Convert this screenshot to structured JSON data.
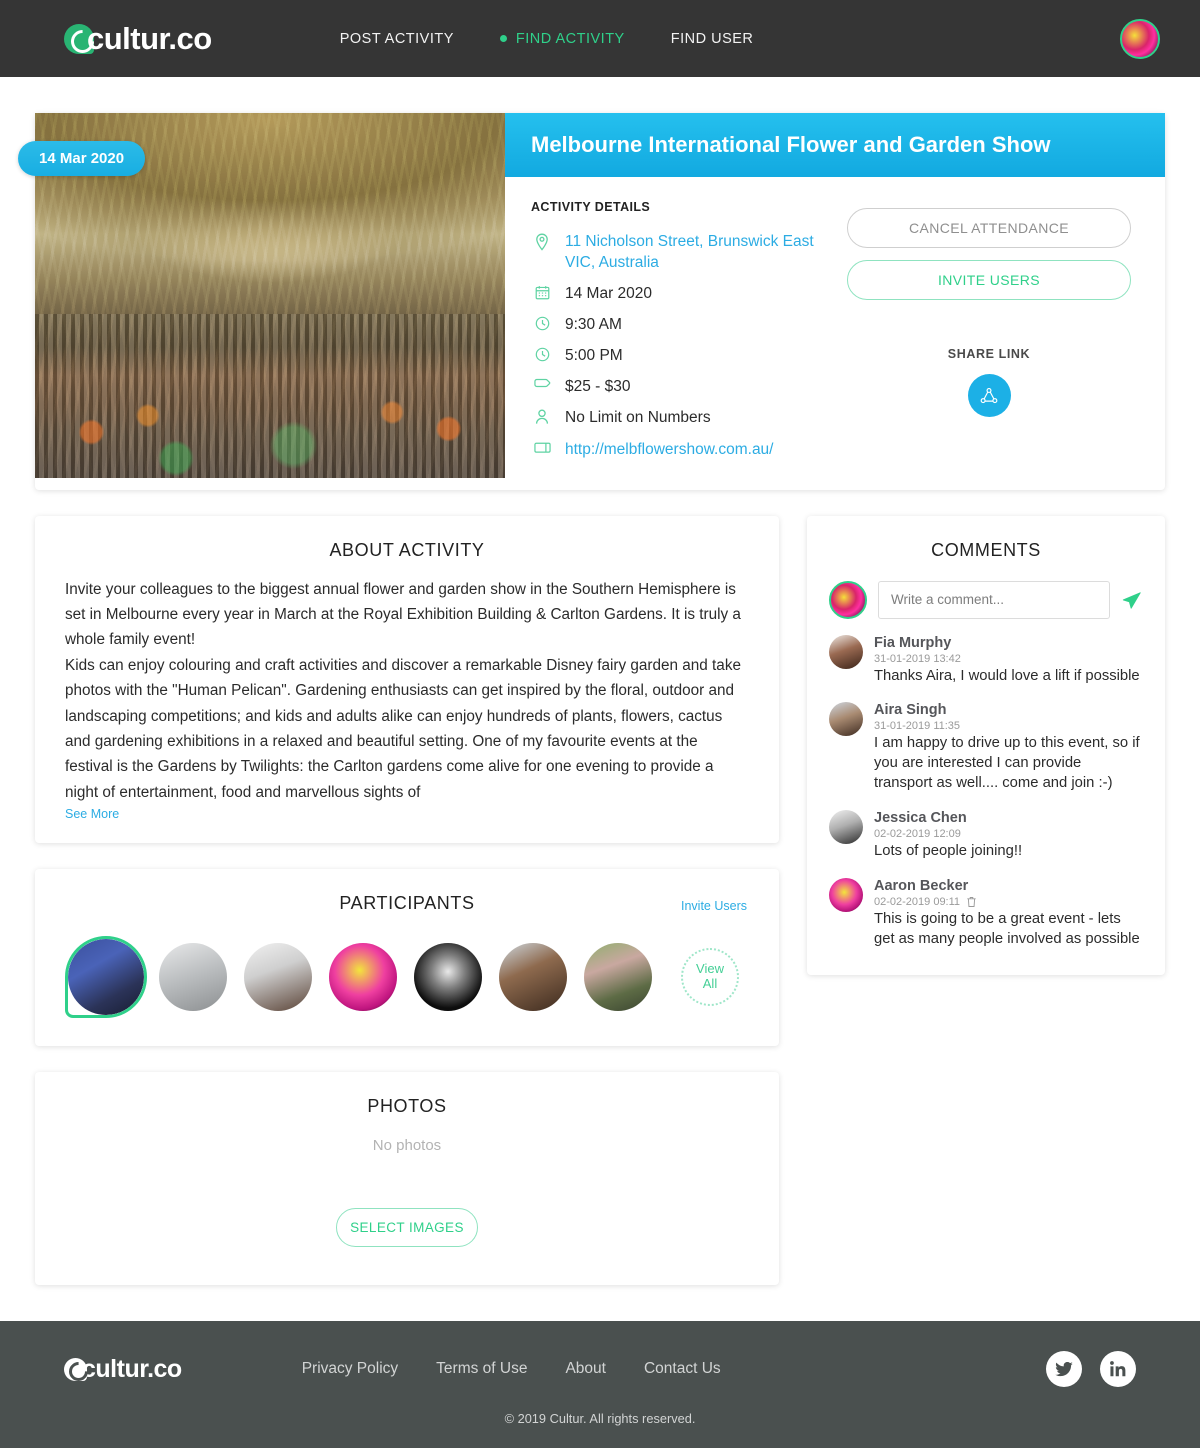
{
  "header": {
    "logo": "cultur.co",
    "nav": [
      {
        "label": "POST ACTIVITY",
        "active": false
      },
      {
        "label": "FIND ACTIVITY",
        "active": true
      },
      {
        "label": "FIND USER",
        "active": false
      }
    ],
    "avatar_name": "user-avatar"
  },
  "hero": {
    "date_badge": "14 Mar 2020",
    "title": "Melbourne International Flower and Garden Show",
    "details_heading": "ACTIVITY DETAILS",
    "details": [
      {
        "icon": "location-pin-icon",
        "text": "11 Nicholson Street, Brunswick East VIC, Australia",
        "link": true
      },
      {
        "icon": "calendar-icon",
        "text": "14 Mar 2020",
        "link": false
      },
      {
        "icon": "clock-icon",
        "text": "9:30 AM",
        "link": false
      },
      {
        "icon": "clock-icon",
        "text": "5:00 PM",
        "link": false
      },
      {
        "icon": "price-tag-icon",
        "text": "$25 - $30",
        "link": false
      },
      {
        "icon": "person-icon",
        "text": "No Limit on Numbers",
        "link": false
      },
      {
        "icon": "web-icon",
        "text": "http://melbflowershow.com.au/",
        "link": true
      }
    ],
    "cancel_label": "CANCEL ATTENDANCE",
    "invite_label": "INVITE USERS",
    "share_label": "SHARE LINK"
  },
  "about": {
    "title": "ABOUT ACTIVITY",
    "paragraphs": [
      "Invite your colleagues to the biggest annual flower and garden show in the Southern Hemisphere is set in Melbourne every year in March at the Royal Exhibition Building & Carlton Gardens. It is truly a whole family event!",
      "Kids can enjoy colouring and craft activities and discover a remarkable Disney fairy garden and take photos with the \"Human Pelican\". Gardening enthusiasts can get inspired by the floral, outdoor and landscaping competitions; and kids and adults alike can enjoy hundreds of plants, flowers, cactus and gardening exhibitions in a relaxed and beautiful setting. One of my favourite events at the festival is the Gardens by Twilights: the Carlton gardens come alive for one evening to provide a night of entertainment, food and marvellous sights of"
    ],
    "see_more": "See More"
  },
  "participants": {
    "title": "PARTICIPANTS",
    "invite_link": "Invite Users",
    "view_all_line1": "View",
    "view_all_line2": "All",
    "avatars": [
      {
        "name": "participant-avatar-1",
        "highlighted": true
      },
      {
        "name": "participant-avatar-2",
        "highlighted": false
      },
      {
        "name": "participant-avatar-3",
        "highlighted": false
      },
      {
        "name": "participant-avatar-4",
        "highlighted": false
      },
      {
        "name": "participant-avatar-5",
        "highlighted": false
      },
      {
        "name": "participant-avatar-6",
        "highlighted": false
      },
      {
        "name": "participant-avatar-7",
        "highlighted": false
      }
    ]
  },
  "photos": {
    "title": "PHOTOS",
    "empty_text": "No photos",
    "select_label": "SELECT IMAGES"
  },
  "comments": {
    "title": "COMMENTS",
    "placeholder": "Write a comment...",
    "input_value": "",
    "items": [
      {
        "name": "Fia Murphy",
        "timestamp": "31-01-2019 13:42",
        "text": "Thanks Aira, I would love a lift if possible",
        "deletable": false
      },
      {
        "name": "Aira Singh",
        "timestamp": "31-01-2019 11:35",
        "text": "I am happy to drive up to this event, so if you are interested I can provide transport as well.... come and join :-)",
        "deletable": false
      },
      {
        "name": "Jessica Chen",
        "timestamp": "02-02-2019 12:09",
        "text": "Lots of people joining!!",
        "deletable": false
      },
      {
        "name": "Aaron Becker",
        "timestamp": "02-02-2019 09:11",
        "text": "This is going to be a great event - lets get as many people involved as possible",
        "deletable": true
      }
    ]
  },
  "footer": {
    "logo": "cultur.co",
    "links": [
      "Privacy Policy",
      "Terms of Use",
      "About",
      "Contact Us"
    ],
    "copyright": "© 2019 Cultur. All rights reserved.",
    "social": [
      "twitter-icon",
      "linkedin-icon"
    ]
  },
  "colors": {
    "brand_green": "#2fd08a",
    "brand_blue": "#1cb0e6",
    "header_bg": "#353535",
    "footer_bg": "#4a504f",
    "link_blue": "#2cace3"
  }
}
